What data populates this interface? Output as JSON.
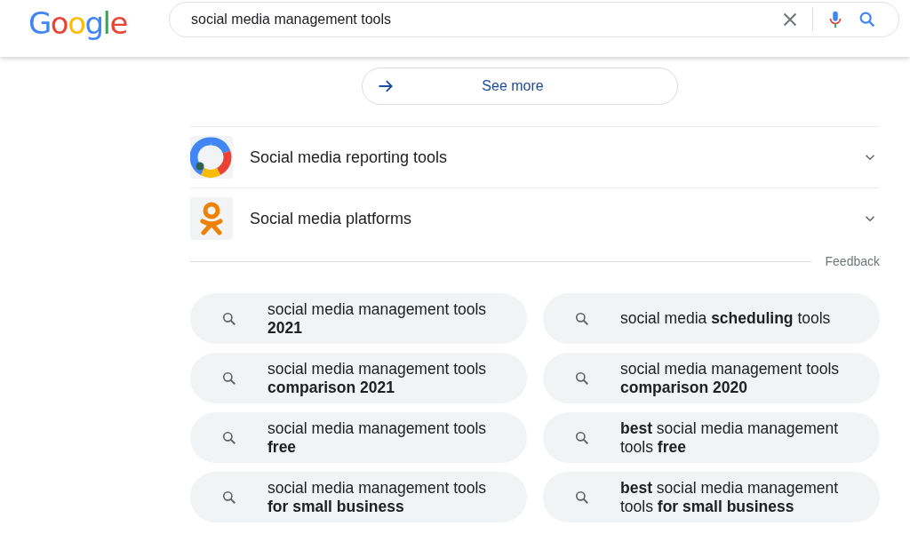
{
  "logo": "Google",
  "search": {
    "value": "social media management tools"
  },
  "see_more": {
    "label": "See more"
  },
  "topics": [
    {
      "label": "Social media reporting tools",
      "kind": "ring",
      "expanded": false
    },
    {
      "label": "Social media platforms",
      "kind": "ok",
      "expanded": false
    }
  ],
  "feedback": "Feedback",
  "related_searches": [
    "social media management tools **2021**",
    "social media **scheduling** tools",
    "social media management tools **comparison 2021**",
    "social media management tools **comparison 2020**",
    "social media management tools **free**",
    "**best** social media management tools **free**",
    "social media management tools **for small business**",
    "**best** social media management tools **for small business**"
  ]
}
